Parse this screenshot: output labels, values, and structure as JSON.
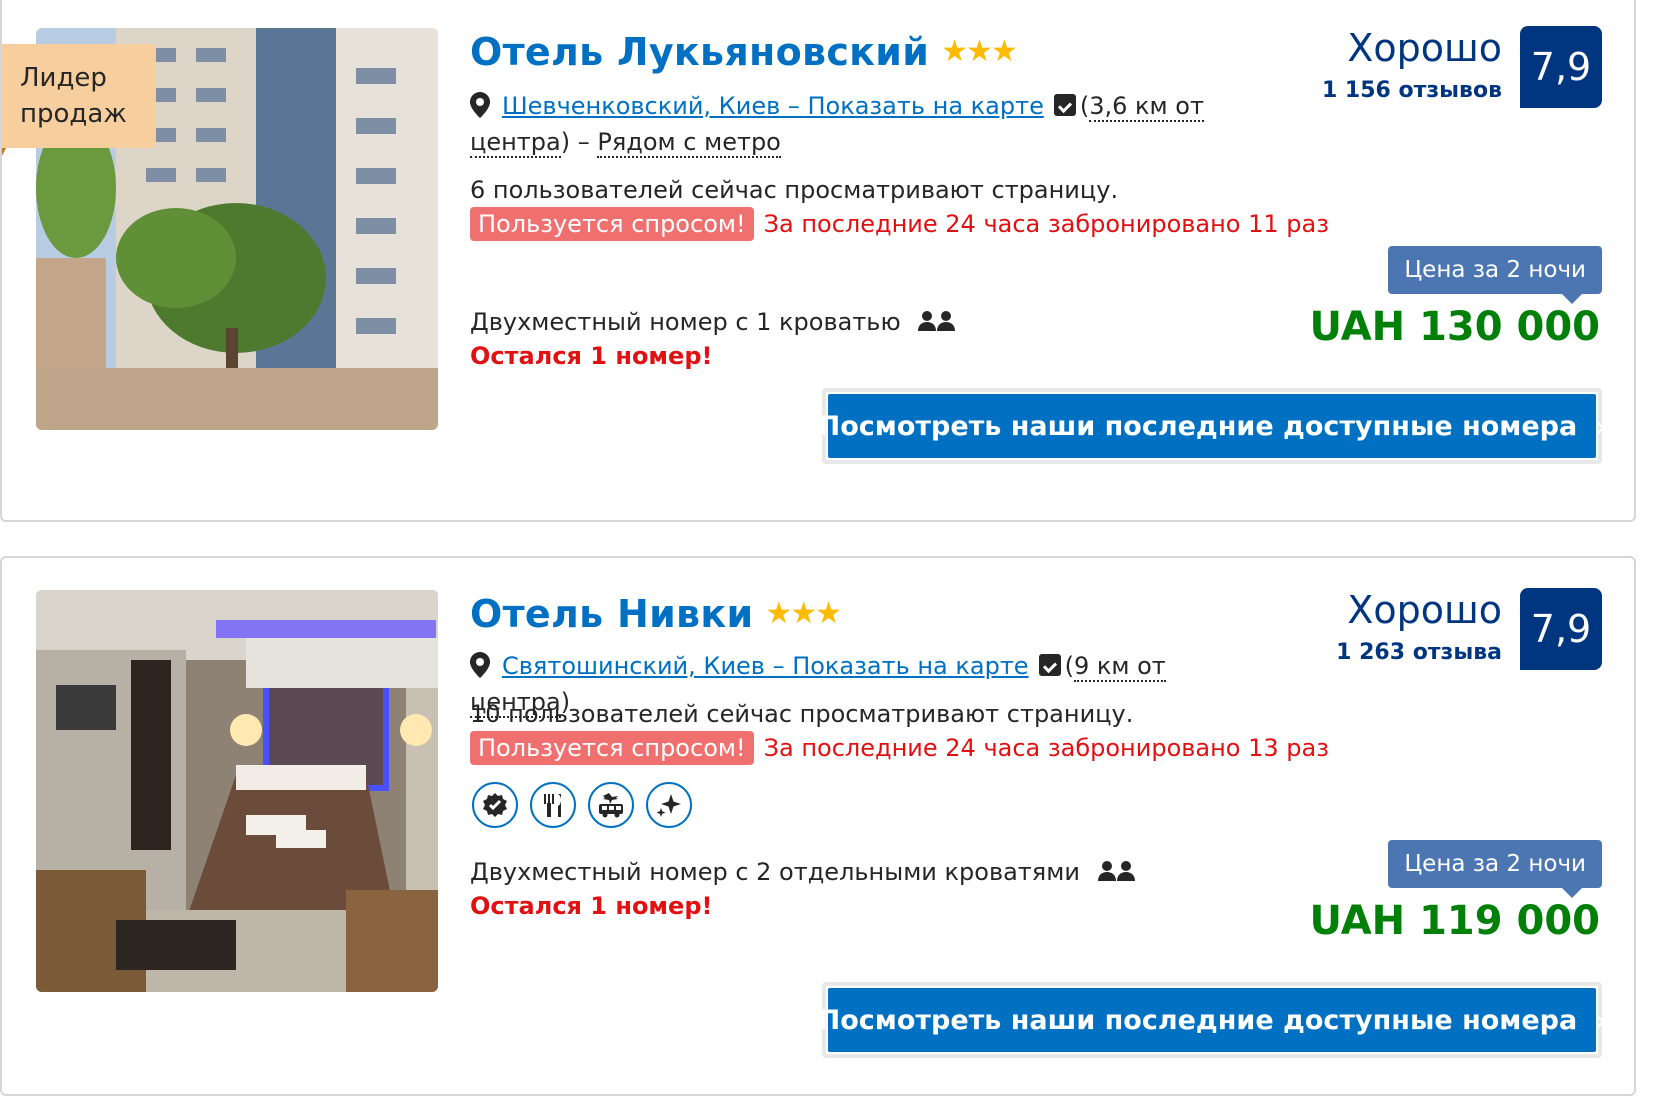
{
  "hotels": [
    {
      "ribbon_line1": "Лидер",
      "ribbon_line2": "продаж",
      "name": "Отель Лукьяновский",
      "stars": "★★★",
      "location_link": "Шевченковский, Киев – Показать на карте",
      "distance_a": "(",
      "distance_b": "3,6 км от",
      "distance_c": "центра",
      "distance_d": ") – ",
      "metro": "Рядом с метро",
      "viewers": "6 пользователей сейчас просматривают страницу.",
      "demand_badge": "Пользуется спросом!",
      "demand_text": "За последние 24 часа забронировано 11 раз",
      "room": "Двухместный номер с 1 кроватью",
      "left": "Остался 1 номер!",
      "score_word": "Хорошо",
      "reviews": "1 156 отзывов",
      "score": "7,9",
      "price_label": "Цена за 2 ночи",
      "price": "UAH 130 000",
      "cta": "Посмотреть наши последние доступные номера",
      "cta_chevron": "›"
    },
    {
      "name": "Отель Нивки",
      "stars": "★★★",
      "location_link": "Святошинский, Киев – Показать на карте",
      "distance_a": "(",
      "distance_b": "9 км от центра",
      "distance_c": ")",
      "viewers": "10 пользователей сейчас просматривают страницу.",
      "demand_badge": "Пользуется спросом!",
      "demand_text": "За последние 24 часа забронировано 13 раз",
      "facilities": [
        "verified-badge-icon",
        "restaurant-icon",
        "airport-shuttle-icon",
        "cleaning-sparkle-icon"
      ],
      "room": "Двухместный номер с 2 отдельными кроватями",
      "left": "Остался 1 номер!",
      "score_word": "Хорошо",
      "reviews": "1 263 отзыва",
      "score": "7,9",
      "price_label": "Цена за 2 ночи",
      "price": "UAH 119 000",
      "cta": "Посмотреть наши последние доступные номера",
      "cta_chevron": "›"
    }
  ],
  "colors": {
    "link_blue": "#0071c2",
    "navy": "#003580",
    "price_green": "#008009",
    "alert_red": "#e21111",
    "ribbon": "#f7cf9f",
    "stars": "#febb02"
  }
}
